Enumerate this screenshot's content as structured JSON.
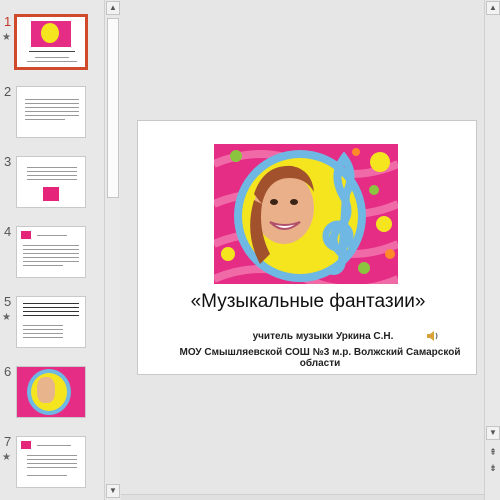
{
  "thumbnails": [
    {
      "number": "1",
      "star": "★",
      "active": true
    },
    {
      "number": "2",
      "star": "",
      "active": false
    },
    {
      "number": "3",
      "star": "",
      "active": false
    },
    {
      "number": "4",
      "star": "",
      "active": false
    },
    {
      "number": "5",
      "star": "★",
      "active": false
    },
    {
      "number": "6",
      "star": "",
      "active": false
    },
    {
      "number": "7",
      "star": "★",
      "active": false
    }
  ],
  "slide": {
    "title": "«Музыкальные фантазии»",
    "teacher": "учитель музыки Уркина С.Н.",
    "school": "МОУ Смышляевской СОШ №3 м.р. Волжский Самарской области"
  },
  "colors": {
    "active_border": "#d04a2c",
    "pink": "#e62d86",
    "yellow": "#f5e51f",
    "clef_blue": "#6fb8e3"
  },
  "icons": {
    "scroll_up": "▲",
    "scroll_down": "▼",
    "prev_slide": "⇞",
    "next_slide": "⇟",
    "speaker": "speaker-icon"
  }
}
